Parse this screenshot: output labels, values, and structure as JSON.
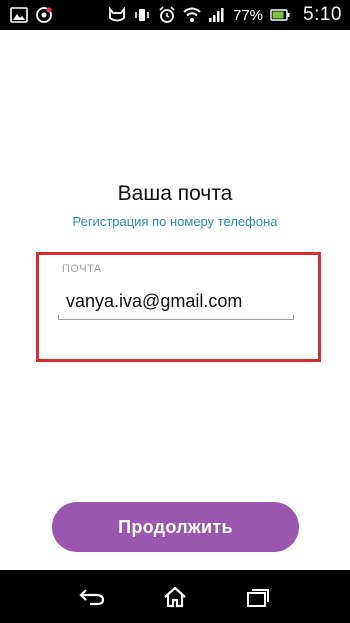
{
  "status_bar": {
    "left_icons": [
      "gallery-icon",
      "media-icon"
    ],
    "right_icons": [
      "cat-icon",
      "vibrate-icon",
      "alarm-icon",
      "wifi-icon",
      "signal-icon",
      "battery-icon"
    ],
    "battery_percent": "77%",
    "time": "5:10"
  },
  "form": {
    "title": "Ваша почта",
    "phone_link": "Регистрация по номеру телефона",
    "email_label": "ПОЧТА",
    "email_value": "vanya.iva@gmail.com"
  },
  "actions": {
    "continue_label": "Продолжить"
  },
  "colors": {
    "accent_purple": "#9b57ad",
    "link_blue": "#2a8fb0",
    "highlight_red": "#d32f2f"
  },
  "nav_bar": {
    "buttons": [
      "back-icon",
      "home-icon",
      "recent-apps-icon"
    ]
  }
}
